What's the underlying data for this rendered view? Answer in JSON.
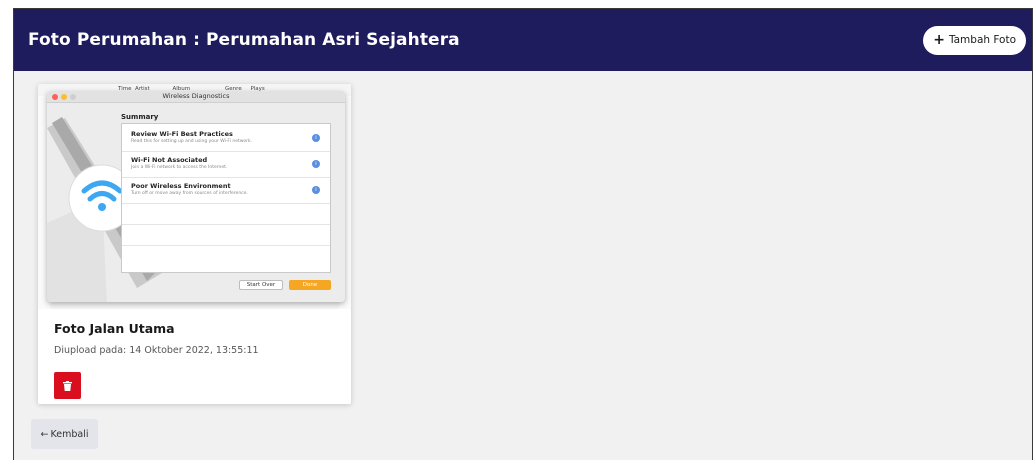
{
  "header": {
    "title": "Foto Perumahan : Perumahan Asri Sejahtera",
    "add_button_label": "Tambah Foto",
    "add_button_icon": "plus-icon",
    "bg_color": "#1e1c5c"
  },
  "photos": [
    {
      "title": "Foto Jalan Utama",
      "uploaded": "Diupload pada: 14 Oktober 2022, 13:55:11",
      "delete_icon": "trash-icon",
      "thumbnail": {
        "window_title": "Wireless Diagnostics",
        "summary_label": "Summary",
        "columns": [
          "Time",
          "Artist",
          "Album",
          "Genre",
          "Plays"
        ],
        "items": [
          {
            "title": "Review Wi-Fi Best Practices",
            "subtitle": "Read this for setting up and using your Wi-Fi network."
          },
          {
            "title": "Wi-Fi Not Associated",
            "subtitle": "Join a Wi-Fi network to access the Internet."
          },
          {
            "title": "Poor Wireless Environment",
            "subtitle": "Turn off or move away from sources of interference."
          }
        ],
        "start_over": "Start Over",
        "done": "Done"
      }
    }
  ],
  "footer": {
    "back_label": "Kembali",
    "back_icon": "arrow-left-icon"
  },
  "colors": {
    "delete": "#d90f1f",
    "done": "#f5a623"
  }
}
